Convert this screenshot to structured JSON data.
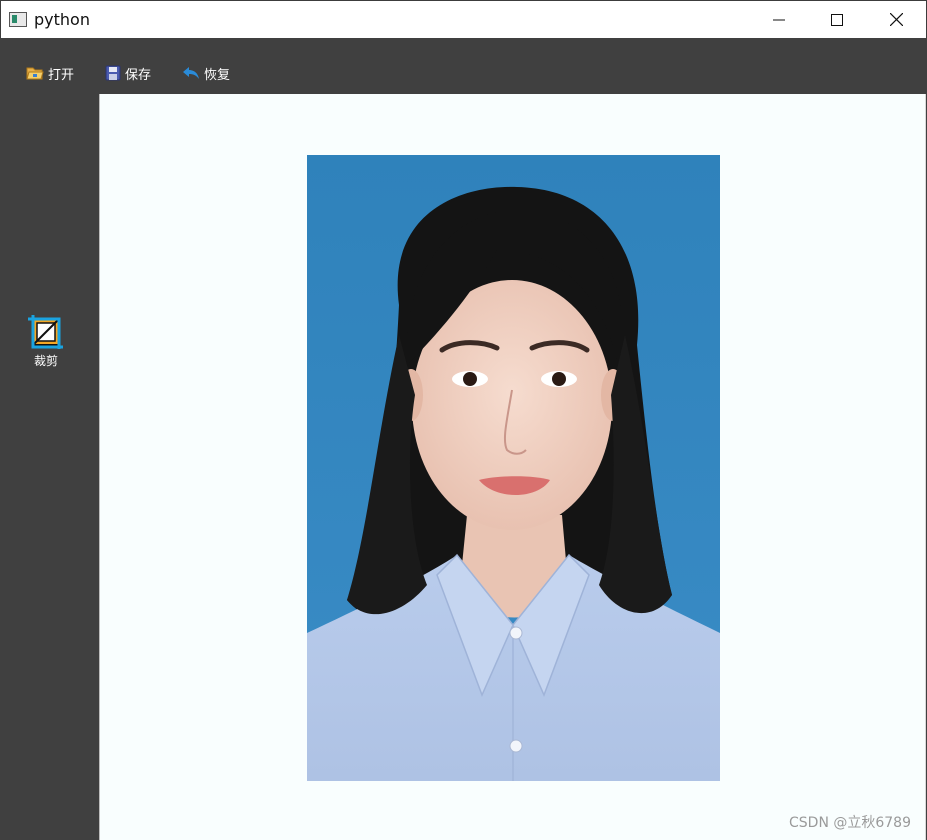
{
  "window": {
    "title": "python"
  },
  "toolbar": {
    "open_label": "打开",
    "save_label": "保存",
    "restore_label": "恢复"
  },
  "sidebar": {
    "crop_label": "裁剪"
  },
  "photo": {
    "description_colors": {
      "background": "#2f86c0",
      "shirt": "#b7c9ea",
      "hair": "#141414",
      "skin": "#f2d3c5"
    }
  },
  "watermark": "CSDN @立秋6789",
  "colors": {
    "toolbar_bg": "#404040",
    "canvas_bg": "#f9fefe",
    "accent_icon": "#2a8bd8"
  }
}
